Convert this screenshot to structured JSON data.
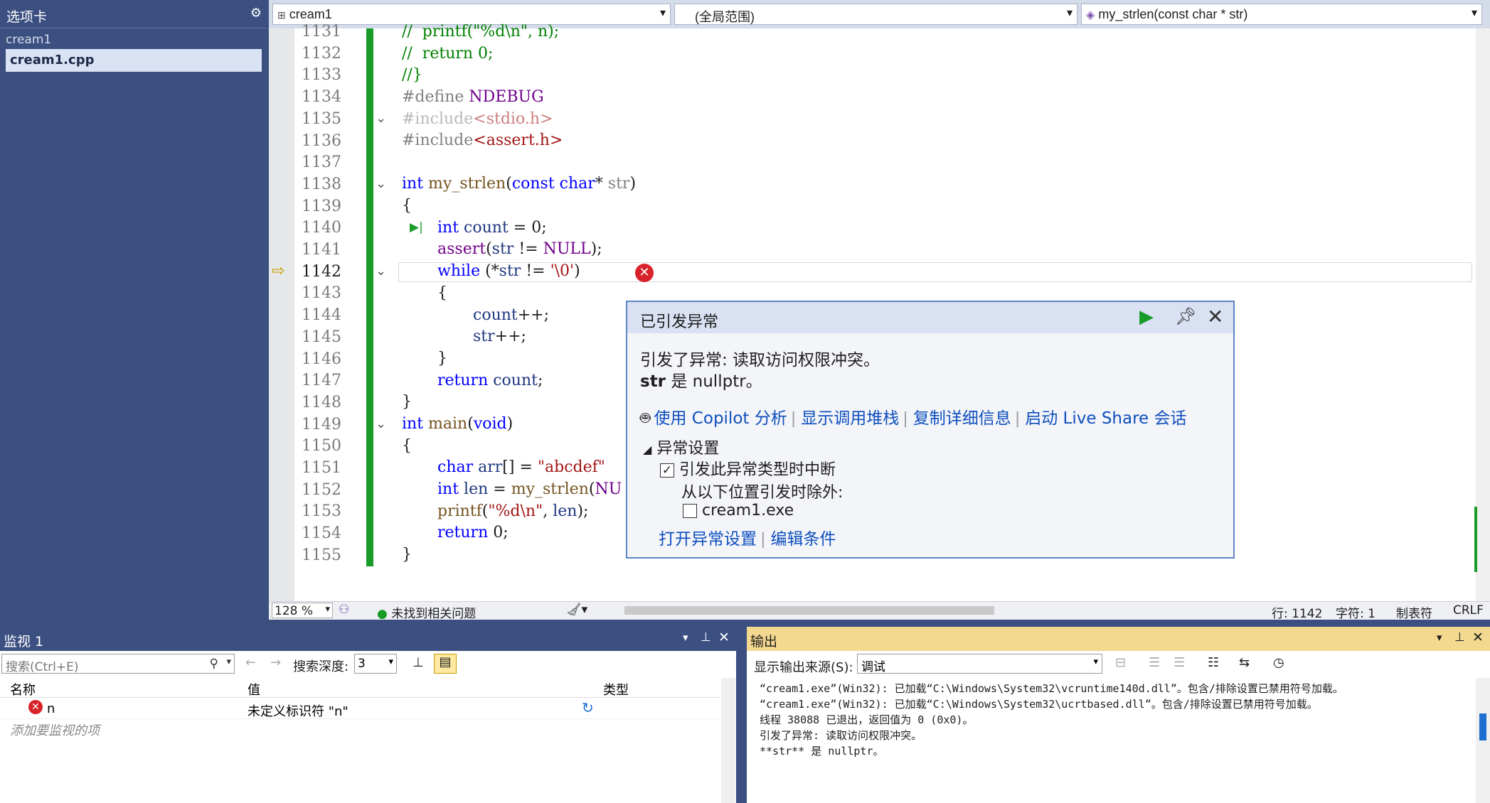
{
  "left_panel": {
    "title": "选项卡",
    "project": "cream1",
    "file": "cream1.cpp"
  },
  "combos": {
    "project": "cream1",
    "scope": "(全局范围)",
    "function": "my_strlen(const char * str)"
  },
  "lines": [
    "1131",
    "1132",
    "1133",
    "1134",
    "1135",
    "1136",
    "1137",
    "1138",
    "1139",
    "1140",
    "1141",
    "1142",
    "1143",
    "1144",
    "1145",
    "1146",
    "1147",
    "1148",
    "1149",
    "1150",
    "1151",
    "1152",
    "1153",
    "1154",
    "1155"
  ],
  "popup": {
    "title": "已引发异常",
    "message": "引发了异常: 读取访问权限冲突。",
    "detail_bold": "str",
    "detail_rest": " 是 nullptr。",
    "links": [
      "使用 Copilot 分析",
      "显示调用堆栈",
      "复制详细信息",
      "启动 Live Share 会话"
    ],
    "section": "异常设置",
    "check1": "引发此异常类型时中断",
    "except_label": "从以下位置引发时除外:",
    "check2": "cream1.exe",
    "footer_links": [
      "打开异常设置",
      "编辑条件"
    ]
  },
  "status": {
    "zoom": "128 %",
    "issues": "未找到相关问题",
    "line": "行: 1142",
    "char": "字符: 1",
    "tab": "制表符",
    "eol": "CRLF"
  },
  "watch": {
    "title": "监视 1",
    "search_placeholder": "搜索(Ctrl+E)",
    "depth_label": "搜索深度:",
    "depth": "3",
    "col_name": "名称",
    "col_value": "值",
    "col_type": "类型",
    "row_name": "n",
    "row_value": "未定义标识符 \"n\"",
    "add_hint": "添加要监视的项"
  },
  "output": {
    "title": "输出",
    "source_label": "显示输出来源(S):",
    "source": "调试",
    "lines": [
      "“cream1.exe”(Win32): 已加载“C:\\Windows\\System32\\vcruntime140d.dll”。包含/排除设置已禁用符号加载。",
      "“cream1.exe”(Win32): 已加载“C:\\Windows\\System32\\ucrtbased.dll”。包含/排除设置已禁用符号加载。",
      "线程 38088 已退出，返回值为 0 (0x0)。",
      "引发了异常: 读取访问权限冲突。",
      "**str** 是 nullptr。"
    ]
  }
}
